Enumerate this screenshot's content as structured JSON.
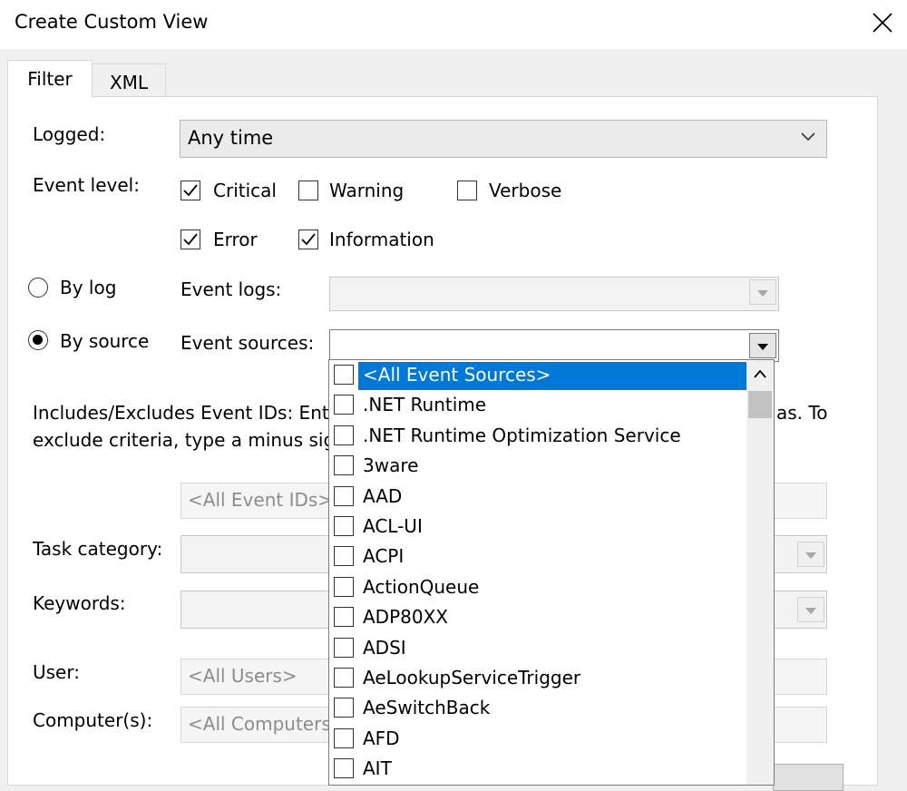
{
  "dialog": {
    "title": "Create Custom View"
  },
  "tabs": [
    {
      "label": "Filter",
      "active": true
    },
    {
      "label": "XML",
      "active": false
    }
  ],
  "filter": {
    "logged_label": "Logged:",
    "logged_value": "Any time",
    "event_level_label": "Event level:",
    "levels": {
      "critical": {
        "label": "Critical",
        "checked": true
      },
      "warning": {
        "label": "Warning",
        "checked": false
      },
      "verbose": {
        "label": "Verbose",
        "checked": false
      },
      "error": {
        "label": "Error",
        "checked": true
      },
      "information": {
        "label": "Information",
        "checked": true
      }
    },
    "by_log_label": "By log",
    "by_source_label": "By source",
    "event_logs_label": "Event logs:",
    "event_sources_label": "Event sources:",
    "event_sources_value": "",
    "includes_text_line1": "Includes/Excludes Event IDs: Enter",
    "includes_text_line1_end": "as. To",
    "includes_text_line2": "exclude criteria, type a minus sign",
    "event_ids_placeholder": "<All Event IDs>",
    "task_category_label": "Task category:",
    "keywords_label": "Keywords:",
    "user_label": "User:",
    "user_placeholder": "<All Users>",
    "computers_label": "Computer(s):",
    "computers_placeholder": "<All Computers"
  },
  "event_sources_list": {
    "selected_index": 0,
    "items": [
      "<All Event Sources>",
      ".NET Runtime",
      ".NET Runtime Optimization Service",
      "3ware",
      "AAD",
      "ACL-UI",
      "ACPI",
      "ActionQueue",
      "ADP80XX",
      "ADSI",
      "AeLookupServiceTrigger",
      "AeSwitchBack",
      "AFD",
      "AIT"
    ]
  },
  "colors": {
    "selection": "#0078d7",
    "window_bg": "#f0f0f0"
  }
}
